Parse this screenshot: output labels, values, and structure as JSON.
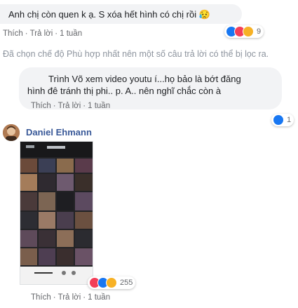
{
  "comment1": {
    "text": "Anh chị còn quen k ạ. S xóa hết hình có chị rồi 😥",
    "reactions": {
      "icons": [
        "like",
        "love",
        "sad"
      ],
      "count": "9"
    }
  },
  "actions": {
    "like": "Thích",
    "reply": "Trả lời",
    "sep": "·",
    "time": "1 tuần"
  },
  "filter_note": "Đã chọn chế độ Phù hợp nhất nên một số câu trả lời có thể bị lọc ra.",
  "reply1": {
    "line1": "Trình Võ xem video youtu í...họ bảo là bớt đăng",
    "line2": "hình đê tránh thị phi.. p. A.. nên nghĩ chắc còn à",
    "reactions": {
      "icons": [
        "like"
      ],
      "count": "1"
    }
  },
  "comment2": {
    "author": "Daniel Ehmann",
    "image_alt": "screenshot of phone photo gallery",
    "reactions": {
      "icons": [
        "love",
        "like",
        "haha"
      ],
      "count": "255"
    }
  },
  "colors": {
    "link": "#385898",
    "bubble": "#f2f3f5",
    "muted": "#65676b",
    "like_blue": "#1877f2"
  }
}
